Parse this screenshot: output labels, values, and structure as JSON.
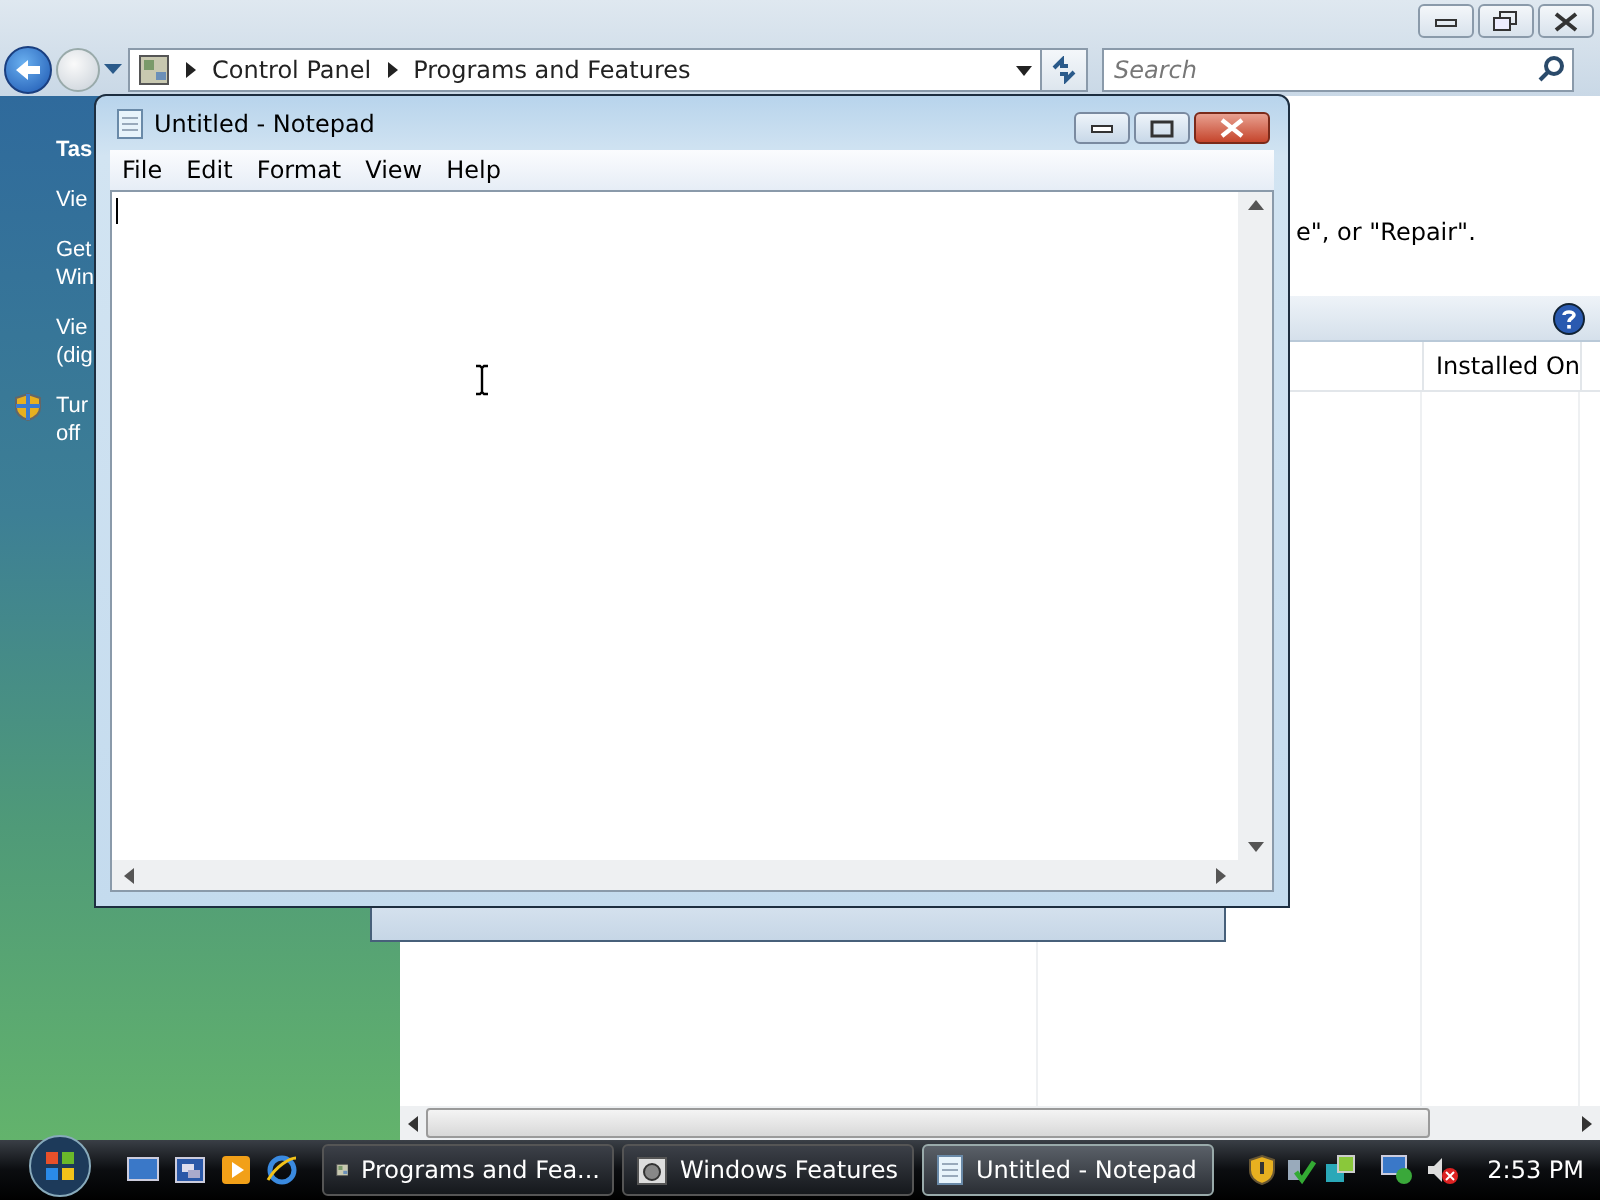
{
  "explorer": {
    "breadcrumbs": [
      "Control Panel",
      "Programs and Features"
    ],
    "search": {
      "placeholder": "Search"
    },
    "tasks": [
      {
        "lines": [
          "Tas"
        ],
        "kind": "heading"
      },
      {
        "lines": [
          "Vie"
        ],
        "kind": "link"
      },
      {
        "lines": [
          "Get",
          "Win"
        ],
        "kind": "link"
      },
      {
        "lines": [
          "Vie",
          "(dig"
        ],
        "kind": "link"
      },
      {
        "lines": [
          "Tur",
          "off"
        ],
        "kind": "shield-link"
      }
    ],
    "instruction": "e\", or \"Repair\".",
    "columns": [
      "Installed On"
    ]
  },
  "notepad": {
    "title": "Untitled - Notepad",
    "menu": [
      "File",
      "Edit",
      "Format",
      "View",
      "Help"
    ]
  },
  "taskbar": {
    "buttons": [
      {
        "label": "Programs and Fea...",
        "kind": "control-panel",
        "selected": false
      },
      {
        "label": "Windows Features",
        "kind": "features",
        "selected": false
      },
      {
        "label": "Untitled - Notepad",
        "kind": "notepad",
        "selected": true
      }
    ],
    "clock": "2:53 PM"
  }
}
